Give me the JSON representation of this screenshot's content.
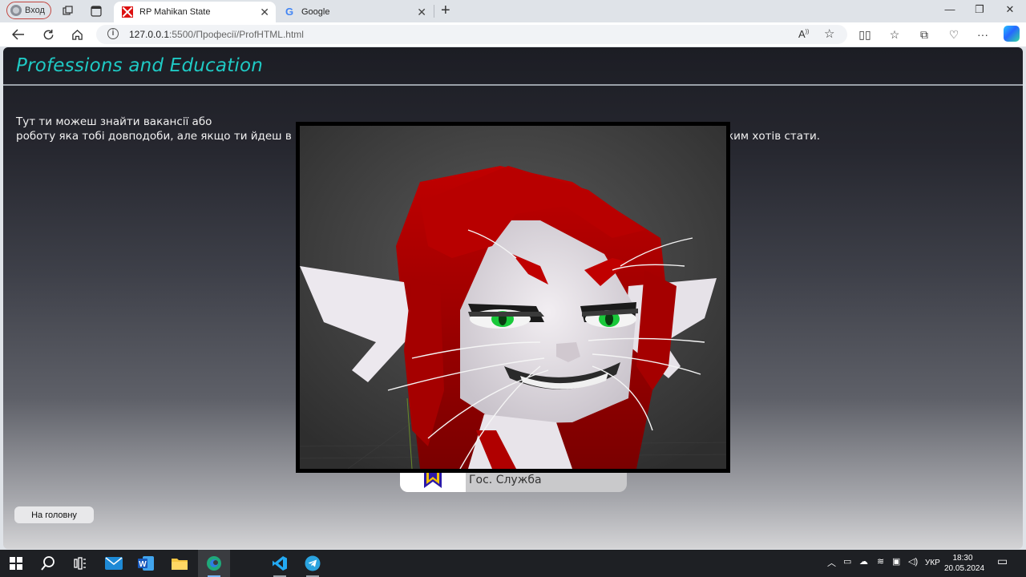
{
  "browser": {
    "profile_label": "Вход",
    "tabs": [
      {
        "title": "RP Mahikan State",
        "active": true
      },
      {
        "title": "Google",
        "active": false
      }
    ],
    "url_host": "127.0.0.1",
    "url_rest": ":5500/Професії/ProfHTML.html"
  },
  "page": {
    "title": "Professions and Education",
    "intro_line1": "Тут ти можеш знайти вакансії або",
    "intro_line2_left": "роботу яка тобі довподоби, але якщо ти йдеш в Г",
    "intro_line2_right": "ким хотів стати.",
    "home_button": "На головну",
    "profession_card_label": "Гос. Служба"
  },
  "modal": {
    "image_subject": "3D render of a white cat-like character with red hair, green eyes and whiskers"
  },
  "taskbar": {
    "language": "УКР",
    "time": "18:30",
    "date": "20.05.2024"
  },
  "colors": {
    "title_accent": "#1fc9c4",
    "hair_red": "#b00000",
    "eye_green": "#19c93a"
  }
}
